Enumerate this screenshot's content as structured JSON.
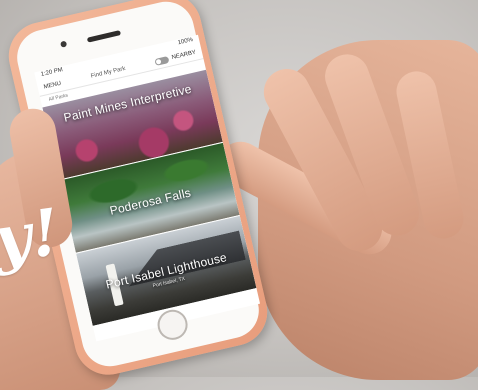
{
  "app": {
    "status_time": "1:20 PM",
    "status_right": "100%",
    "nav_left": "MENU",
    "nav_title": "Find My Park",
    "nav_right_label": "NEARBY",
    "sub_label": "All Parks"
  },
  "cards": [
    {
      "title": "Paint Mines Interpretive",
      "subtitle": ""
    },
    {
      "title": "Poderosa Falls",
      "subtitle": ""
    },
    {
      "title": "Port Isabel Lighthouse",
      "subtitle": "Port Isabel, TX"
    }
  ],
  "overlay": {
    "scribble": "y!"
  },
  "colors": {
    "phone_case": "#f0a888",
    "background": "#cfccc9"
  }
}
